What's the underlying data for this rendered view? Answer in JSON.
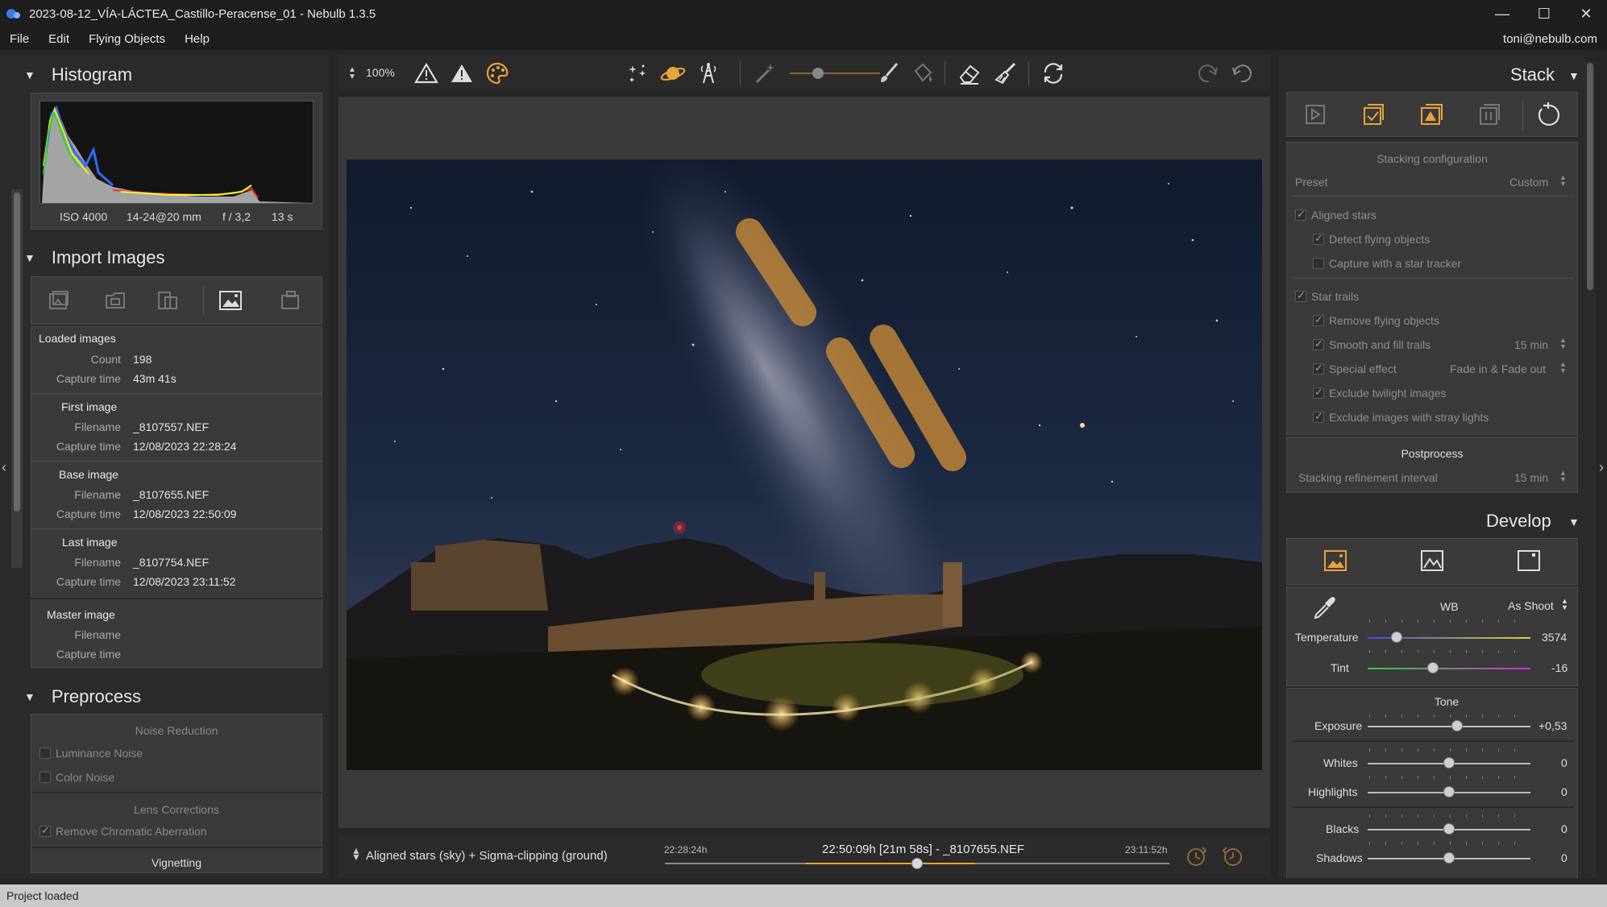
{
  "window": {
    "title": "2023-08-12_VÍA-LÁCTEA_Castillo-Peracense_01 - Nebulb 1.3.5",
    "minimize": "—",
    "maximize": "☐",
    "close": "✕"
  },
  "menu": {
    "items": [
      "File",
      "Edit",
      "Flying Objects",
      "Help"
    ],
    "user": "toni@nebulb.com"
  },
  "histogram": {
    "title": "Histogram",
    "iso": "ISO 4000",
    "lens": "14-24@20 mm",
    "aperture": "f / 3,2",
    "shutter": "13 s"
  },
  "import": {
    "title": "Import Images",
    "loaded": {
      "header": "Loaded images",
      "count_label": "Count",
      "count": "198",
      "capture_label": "Capture time",
      "capture": "43m 41s"
    },
    "first": {
      "header": "First image",
      "filename_label": "Filename",
      "filename": "_8107557.NEF",
      "capture_label": "Capture time",
      "capture": "12/08/2023 22:28:24"
    },
    "base": {
      "header": "Base image",
      "filename_label": "Filename",
      "filename": "_8107655.NEF",
      "capture_label": "Capture time",
      "capture": "12/08/2023 22:50:09"
    },
    "last": {
      "header": "Last image",
      "filename_label": "Filename",
      "filename": "_8107754.NEF",
      "capture_label": "Capture time",
      "capture": "12/08/2023 23:11:52"
    },
    "master": {
      "header": "Master image",
      "filename_label": "Filename",
      "capture_label": "Capture time"
    }
  },
  "preprocess": {
    "title": "Preprocess",
    "noise_reduction": "Noise Reduction",
    "luminance_noise": "Luminance Noise",
    "color_noise": "Color Noise",
    "lens_corrections": "Lens Corrections",
    "remove_ca": "Remove Chromatic Aberration",
    "vignetting": "Vignetting"
  },
  "toolbar": {
    "zoom": "100%"
  },
  "bottom": {
    "mode": "Aligned stars (sky) + Sigma-clipping (ground)",
    "start": "22:28:24h",
    "end": "23:11:52h",
    "current": "22:50:09h [21m 58s] - _8107655.NEF",
    "position": 0.5
  },
  "stack": {
    "title": "Stack",
    "config_title": "Stacking configuration",
    "preset_label": "Preset",
    "preset_value": "Custom",
    "aligned_stars": "Aligned stars",
    "detect_flying": "Detect flying objects",
    "capture_tracker": "Capture with a star tracker",
    "star_trails": "Star trails",
    "remove_flying": "Remove flying objects",
    "smooth_fill": "Smooth and fill trails",
    "smooth_fill_value": "15 min",
    "special_effect": "Special effect",
    "special_effect_value": "Fade in & Fade out",
    "exclude_twilight": "Exclude twilight images",
    "exclude_stray": "Exclude images with stray lights",
    "postprocess": "Postprocess",
    "refinement_label": "Stacking refinement interval",
    "refinement_value": "15 min"
  },
  "develop": {
    "title": "Develop",
    "wb_label": "WB",
    "wb_value": "As Shoot",
    "temperature_label": "Temperature",
    "temperature_value": "3574",
    "temperature_pos": 0.18,
    "tint_label": "Tint",
    "tint_value": "-16",
    "tint_pos": 0.4,
    "tone_title": "Tone",
    "exposure_label": "Exposure",
    "exposure_value": "+0,53",
    "exposure_pos": 0.55,
    "whites_label": "Whites",
    "whites_value": "0",
    "highlights_label": "Highlights",
    "highlights_value": "0",
    "blacks_label": "Blacks",
    "blacks_value": "0",
    "shadows_label": "Shadows",
    "shadows_value": "0"
  },
  "status": {
    "text": "Project loaded"
  },
  "colors": {
    "accent": "#e8a33a",
    "panel": "#3a3a3a"
  }
}
